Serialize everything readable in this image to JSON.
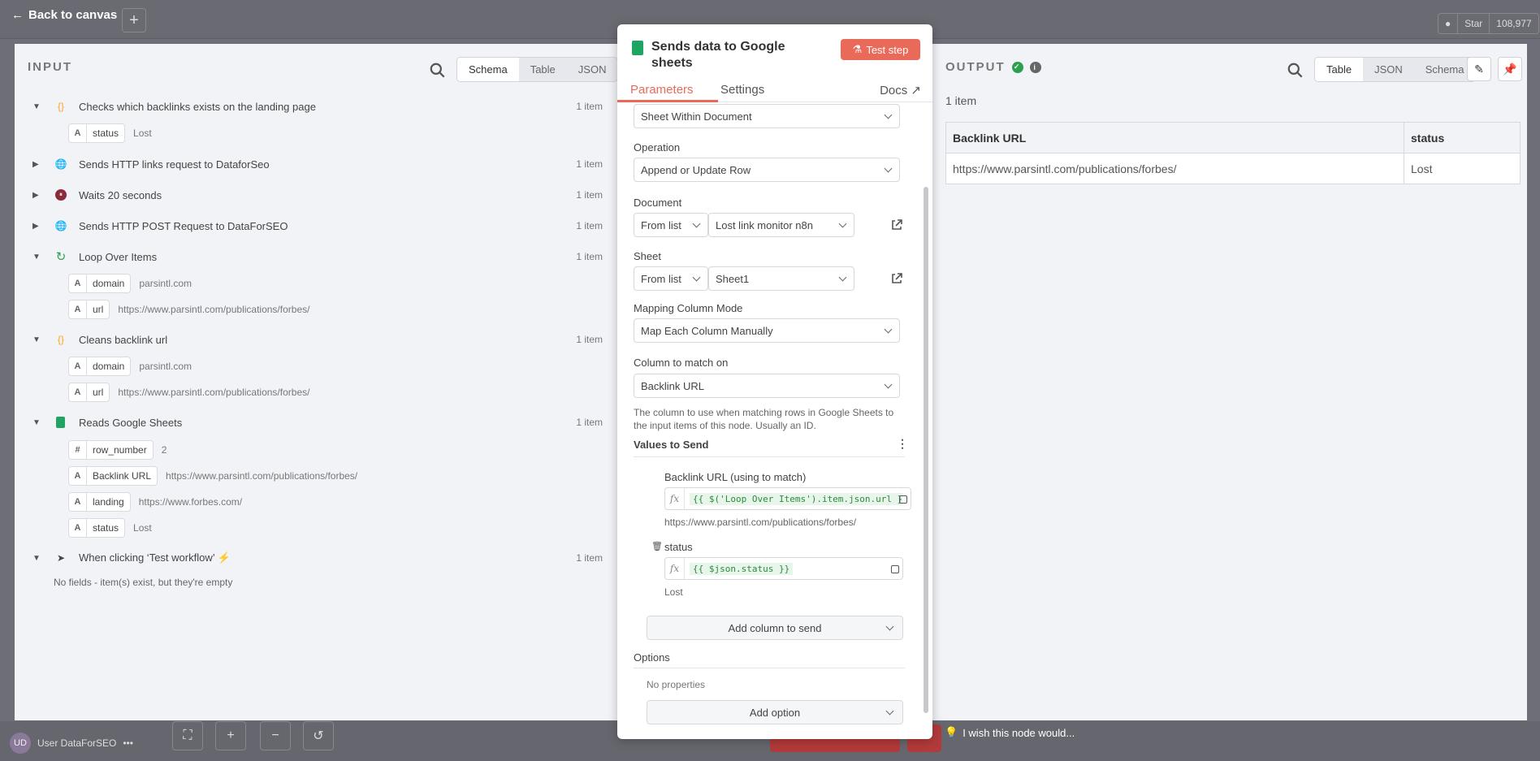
{
  "topbar": {
    "back_label": "Back to canvas",
    "star_label": "Star",
    "star_count": "108,977"
  },
  "footer": {
    "user_initials": "UD",
    "user_name": "User DataForSEO",
    "wish_text": "I wish this node would..."
  },
  "input_panel": {
    "title": "INPUT",
    "view_tabs": [
      "Schema",
      "Table",
      "JSON"
    ],
    "active_view": "Schema",
    "nodes": [
      {
        "label": "Checks which backlinks exists on the landing page",
        "count": "1 item",
        "icon": "code-braces-icon",
        "expanded": true,
        "fields": [
          {
            "type": "A",
            "name": "status",
            "value": "Lost"
          }
        ]
      },
      {
        "label": "Sends HTTP links request to DataforSeo",
        "count": "1 item",
        "icon": "globe-icon",
        "expanded": false,
        "fields": []
      },
      {
        "label": "Waits 20 seconds",
        "count": "1 item",
        "icon": "wait-icon",
        "expanded": false,
        "fields": []
      },
      {
        "label": "Sends HTTP POST Request to DataForSEO",
        "count": "1 item",
        "icon": "globe-icon",
        "expanded": false,
        "fields": []
      },
      {
        "label": "Loop Over Items",
        "count": "1 item",
        "icon": "loop-icon",
        "expanded": true,
        "fields": [
          {
            "type": "A",
            "name": "domain",
            "value": "parsintl.com"
          },
          {
            "type": "A",
            "name": "url",
            "value": "https://www.parsintl.com/publications/forbes/"
          }
        ]
      },
      {
        "label": "Cleans backlink url",
        "count": "1 item",
        "icon": "code-braces-icon",
        "expanded": true,
        "fields": [
          {
            "type": "A",
            "name": "domain",
            "value": "parsintl.com"
          },
          {
            "type": "A",
            "name": "url",
            "value": "https://www.parsintl.com/publications/forbes/"
          }
        ]
      },
      {
        "label": "Reads Google Sheets",
        "count": "1 item",
        "icon": "google-sheets-icon",
        "expanded": true,
        "fields": [
          {
            "type": "#",
            "name": "row_number",
            "value": "2"
          },
          {
            "type": "A",
            "name": "Backlink URL",
            "value": "https://www.parsintl.com/publications/forbes/"
          },
          {
            "type": "A",
            "name": "landing",
            "value": "https://www.forbes.com/"
          },
          {
            "type": "A",
            "name": "status",
            "value": "Lost"
          }
        ]
      },
      {
        "label": "When clicking ‘Test workflow’",
        "count": "1 item",
        "icon": "cursor-icon",
        "expanded": true,
        "fields": [],
        "note": "No fields - item(s) exist, but they're empty"
      }
    ]
  },
  "modal": {
    "title": "Sends data to Google sheets",
    "test_step_label": "Test step",
    "tabs": {
      "parameters": "Parameters",
      "settings": "Settings",
      "docs": "Docs"
    },
    "resource_value": "Sheet Within Document",
    "operation": {
      "label": "Operation",
      "value": "Append or Update Row"
    },
    "document": {
      "label": "Document",
      "mode": "From list",
      "value": "Lost link monitor n8n"
    },
    "sheet": {
      "label": "Sheet",
      "mode": "From list",
      "value": "Sheet1"
    },
    "mapping": {
      "label": "Mapping Column Mode",
      "value": "Map Each Column Manually"
    },
    "match_column": {
      "label": "Column to match on",
      "value": "Backlink URL",
      "hint": "The column to use when matching rows in Google Sheets to the input items of this node. Usually an ID."
    },
    "values_to_send": {
      "title": "Values to Send",
      "items": [
        {
          "label": "Backlink URL (using to match)",
          "expression": "{{ $('Loop Over Items').item.json.url }}",
          "preview": "https://www.parsintl.com/publications/forbes/"
        },
        {
          "label": "status",
          "expression": "{{ $json.status }}",
          "preview": "Lost"
        }
      ],
      "add_label": "Add column to send"
    },
    "options": {
      "title": "Options",
      "empty": "No properties",
      "add_label": "Add option"
    }
  },
  "output_panel": {
    "title": "OUTPUT",
    "view_tabs": [
      "Table",
      "JSON",
      "Schema"
    ],
    "active_view": "Table",
    "item_count": "1 item",
    "columns": [
      "Backlink URL",
      "status"
    ],
    "rows": [
      [
        "https://www.parsintl.com/publications/forbes/",
        "Lost"
      ]
    ]
  },
  "colors": {
    "accent": "#ea6a5a",
    "success": "#2e9e4f",
    "sheets_green": "#1fa463"
  }
}
